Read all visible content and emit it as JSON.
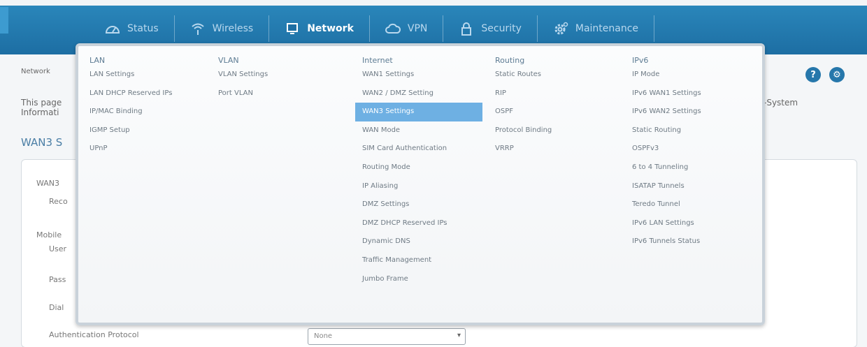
{
  "nav": {
    "tabs": [
      {
        "label": "Status",
        "icon": "speedometer-icon"
      },
      {
        "label": "Wireless",
        "icon": "wifi-icon"
      },
      {
        "label": "Network",
        "icon": "monitor-icon",
        "active": true
      },
      {
        "label": "VPN",
        "icon": "cloud-icon"
      },
      {
        "label": "Security",
        "icon": "lock-icon"
      },
      {
        "label": "Maintenance",
        "icon": "gear-icon"
      }
    ]
  },
  "page": {
    "breadcrumb": "Network",
    "desc_line1": "This page",
    "desc_line2": "Informati",
    "desc_right": "-System",
    "section_title": "WAN3 S",
    "fields": {
      "wan3": "WAN3",
      "reco": "Reco",
      "mobile": "Mobile",
      "user": "User",
      "pass": "Pass",
      "dial": "Dial",
      "auth": "Authentication Protocol"
    },
    "auth_select_value": "None"
  },
  "menu": {
    "columns": [
      {
        "title": "LAN",
        "items": [
          "LAN Settings",
          "LAN DHCP Reserved IPs",
          "IP/MAC Binding",
          "IGMP Setup",
          "UPnP"
        ]
      },
      {
        "title": "VLAN",
        "items": [
          "VLAN Settings",
          "Port VLAN"
        ]
      },
      {
        "title": "Internet",
        "items": [
          "WAN1 Settings",
          "WAN2 / DMZ Setting",
          "WAN3 Settings",
          "WAN Mode",
          "SIM Card Authentication",
          "Routing Mode",
          "IP Aliasing",
          "DMZ Settings",
          "DMZ DHCP Reserved IPs",
          "Dynamic DNS",
          "Traffic Management",
          "Jumbo Frame"
        ],
        "selected_index": 2
      },
      {
        "title": "Routing",
        "items": [
          "Static Routes",
          "RIP",
          "OSPF",
          "Protocol Binding",
          "VRRP"
        ]
      },
      {
        "title": "IPv6",
        "items": [
          "IP Mode",
          "IPv6 WAN1 Settings",
          "IPv6 WAN2 Settings",
          "Static Routing",
          "OSPFv3",
          "6 to 4 Tunneling",
          "ISATAP Tunnels",
          "Teredo Tunnel",
          "IPv6 LAN Settings",
          "IPv6 Tunnels Status"
        ]
      }
    ]
  }
}
